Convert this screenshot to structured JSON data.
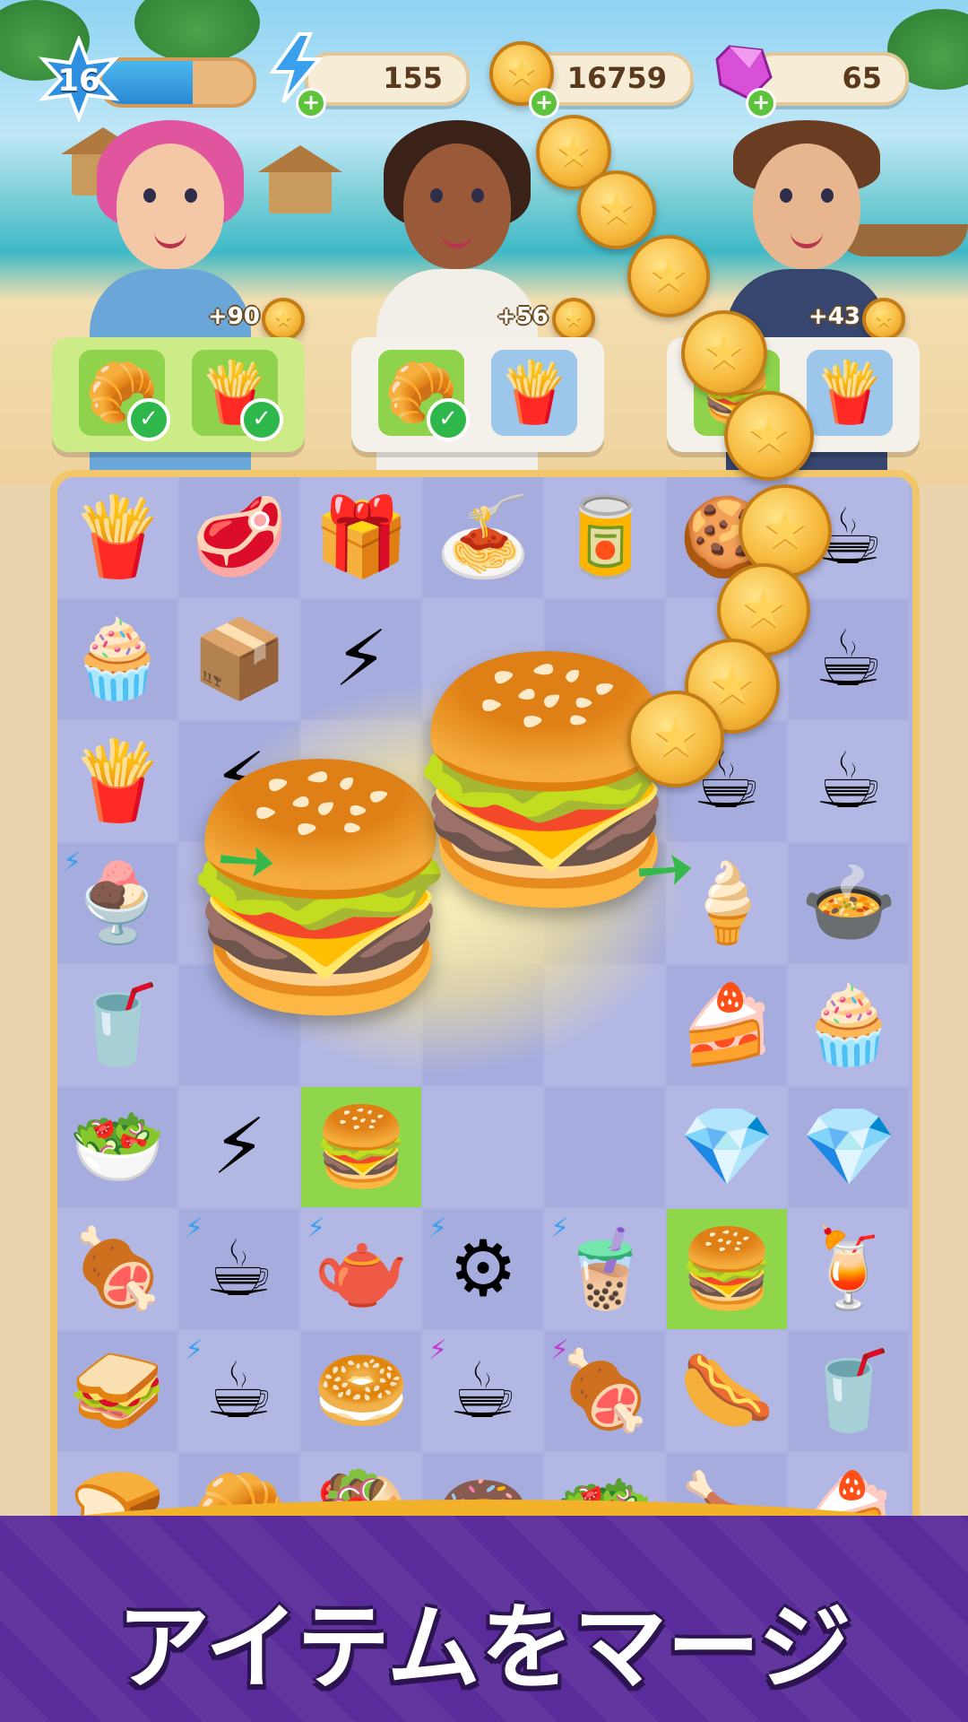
{
  "hud": {
    "level": "16",
    "level_progress": 0.6,
    "energy": "155",
    "coins": "16759",
    "gems": "65"
  },
  "customers": [
    {
      "reward": "+90",
      "items": [
        "croissant",
        "fries"
      ],
      "done": [
        true,
        true
      ]
    },
    {
      "reward": "+56",
      "items": [
        "croissant",
        "fries"
      ],
      "done": [
        true,
        false
      ]
    },
    {
      "reward": "+43",
      "items": [
        "burger",
        "fries"
      ],
      "done": [
        false,
        false
      ]
    }
  ],
  "icons": {
    "level": "star-badge-icon",
    "energy": "lightning-icon",
    "coin": "coin-icon",
    "gem": "gem-icon",
    "check": "checkmark-icon"
  },
  "board_items": [
    [
      "fries",
      "steak",
      "gem-box",
      "pasta-plate",
      "cola-can",
      "macaron",
      "coffee-cup"
    ],
    [
      "cupcake",
      "energy-box",
      "energy-pack",
      "",
      "",
      "",
      "coffee-cup"
    ],
    [
      "fries-basket",
      "energy-small",
      "",
      "",
      "",
      "latte-cup",
      "latte-cup"
    ],
    [
      "mocha-drink",
      "",
      "",
      "",
      "",
      "ice-cream",
      "curry-bowl"
    ],
    [
      "milkshake",
      "",
      "",
      "",
      "",
      "swiss-roll",
      "macaron-box"
    ],
    [
      "salad-bowl",
      "energy-pack",
      "burger",
      "",
      "",
      "gem",
      "gem"
    ],
    [
      "grilled-meat",
      "coffee-machine",
      "moka-pot",
      "coffee-grinder",
      "iced-coffee",
      "burger",
      "iced-tea"
    ],
    [
      "sandwich",
      "espresso-machine",
      "bagel",
      "espresso-machine",
      "ribs",
      "hoagie",
      "iced-cola"
    ],
    [
      "bread",
      "croissant",
      "kebab",
      "donuts",
      "salad",
      "roast-chicken",
      "cake-slice"
    ]
  ],
  "merge_tagline": "アイテムをマージ",
  "colors": {
    "banner": "#5a2b9a",
    "board_frame": "#f2c66a",
    "highlight": "#8fd64a",
    "check": "#2eb74a"
  }
}
